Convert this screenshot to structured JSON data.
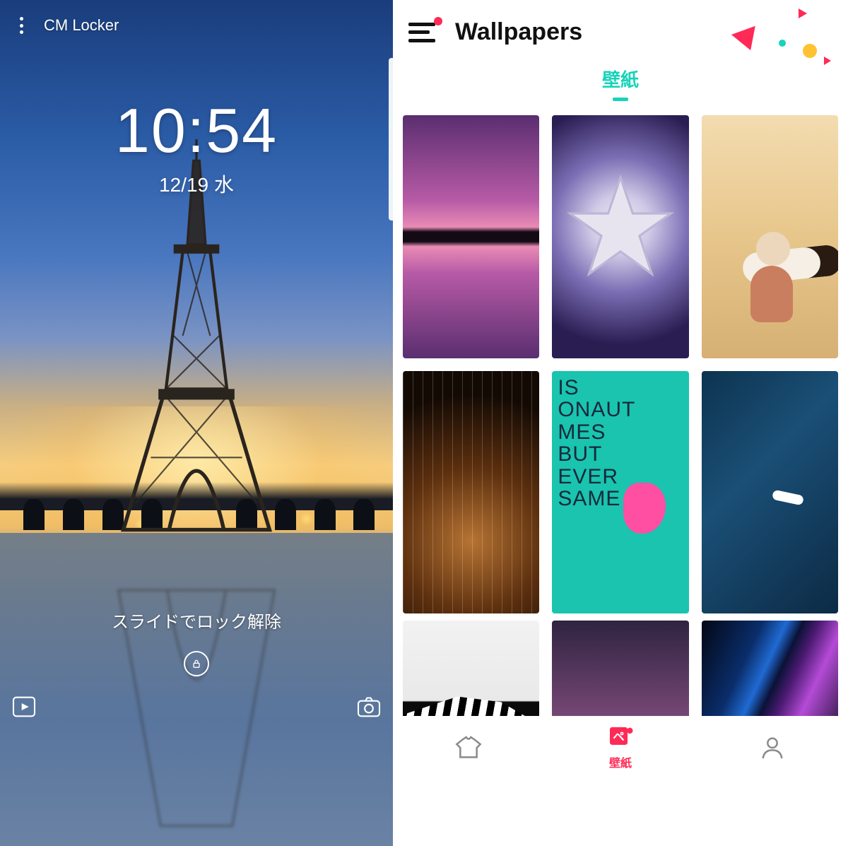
{
  "lock": {
    "app_name": "CM Locker",
    "time": "10:54",
    "date": "12/19 水",
    "unlock_hint": "スライドでロック解除",
    "icons": {
      "more": "more-vertical-icon",
      "lock": "lock-icon",
      "media": "media-shortcut-icon",
      "camera": "camera-shortcut-icon"
    }
  },
  "wallpapers": {
    "header_title": "Wallpapers",
    "menu_icon": "hamburger-menu-icon",
    "notification_dot": true,
    "tab": {
      "label": "壁紙",
      "active": true
    },
    "grid": [
      {
        "id": "sunset-reflection"
      },
      {
        "id": "silver-star"
      },
      {
        "id": "child-guitar-beach"
      },
      {
        "id": "ukulele-closeup"
      },
      {
        "id": "graffiti-astronaut-text"
      },
      {
        "id": "seagull-ocean"
      },
      {
        "id": "zebra-bw"
      },
      {
        "id": "water-drop-purple"
      },
      {
        "id": "aurora-diagonal"
      }
    ],
    "bottom_nav": {
      "themes": {
        "label": "",
        "icon": "tshirt-icon"
      },
      "wallpapers": {
        "label": "壁紙",
        "symbol": "ペ",
        "active": true
      },
      "profile": {
        "label": "",
        "icon": "person-icon"
      }
    }
  }
}
